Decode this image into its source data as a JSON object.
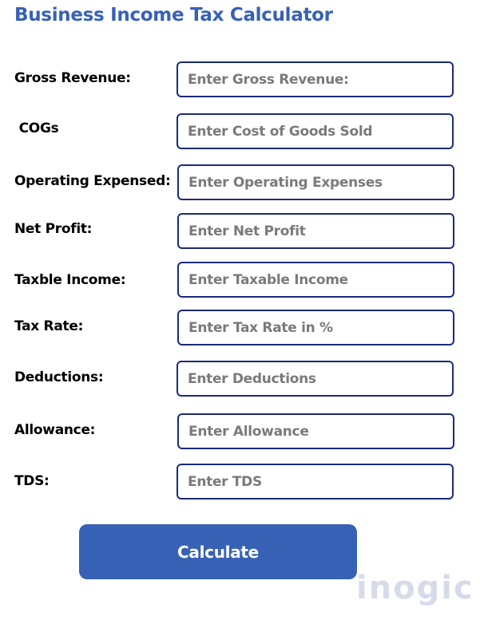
{
  "header": {
    "title": "Business Income Tax Calculator"
  },
  "form": {
    "fields": [
      {
        "label": "Gross Revenue:",
        "placeholder": "Enter Gross Revenue:",
        "value": ""
      },
      {
        "label": " COGs",
        "placeholder": "Enter Cost of Goods Sold",
        "value": ""
      },
      {
        "label": "Operating Expensed:",
        "placeholder": "Enter Operating Expenses",
        "value": ""
      },
      {
        "label": "Net Profit:",
        "placeholder": "Enter Net Profit",
        "value": ""
      },
      {
        "label": "Taxble Income:",
        "placeholder": "Enter Taxable Income",
        "value": ""
      },
      {
        "label": "Tax Rate:",
        "placeholder": "Enter Tax Rate in %",
        "value": ""
      },
      {
        "label": "Deductions:",
        "placeholder": "Enter Deductions",
        "value": ""
      },
      {
        "label": "Allowance:",
        "placeholder": "Enter Allowance",
        "value": ""
      },
      {
        "label": "TDS:",
        "placeholder": "Enter TDS",
        "value": ""
      }
    ],
    "calculate_label": "Calculate"
  },
  "watermark": {
    "text": "inogic"
  },
  "colors": {
    "accent": "#3761b4",
    "field_border": "#1b2a7a",
    "placeholder": "#7a7a7a",
    "watermark": "#d6dbea"
  }
}
